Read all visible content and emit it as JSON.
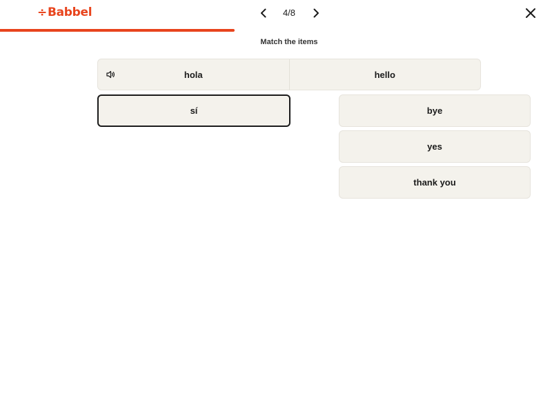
{
  "header": {
    "logo_text": "Babbel",
    "brand_color": "#e8441d",
    "counter": "4/8",
    "prev_icon": "chevron-left-icon",
    "next_icon": "chevron-right-icon",
    "close_icon": "close-icon"
  },
  "progress": {
    "fraction": 0.425
  },
  "exercise": {
    "instruction": "Match the items",
    "matched": {
      "source": "hola",
      "target": "hello",
      "audio_icon": "speaker-icon"
    },
    "left_items": [
      {
        "label": "sí",
        "selected": true
      }
    ],
    "right_items": [
      {
        "label": "bye"
      },
      {
        "label": "yes"
      },
      {
        "label": "thank you"
      }
    ]
  }
}
